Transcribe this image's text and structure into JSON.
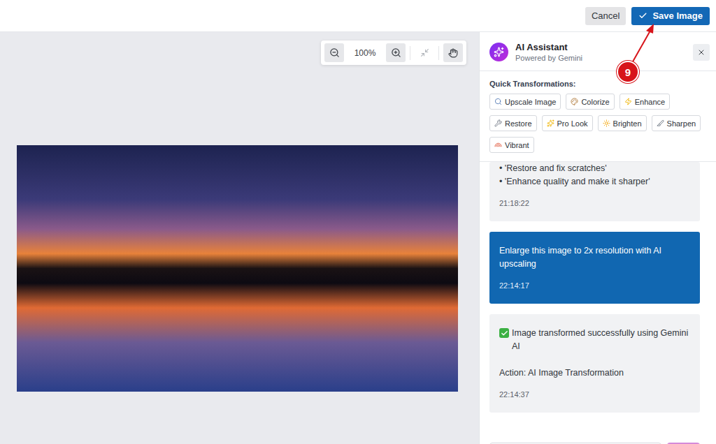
{
  "topbar": {
    "cancel": "Cancel",
    "save": "Save Image"
  },
  "annotation": {
    "badge": "9"
  },
  "zoom": {
    "level": "100%"
  },
  "assistant": {
    "title": "AI Assistant",
    "subtitle": "Powered by Gemini"
  },
  "quick_transformations": {
    "heading": "Quick Transformations:",
    "chips": [
      "Upscale Image",
      "Colorize",
      "Enhance",
      "Restore",
      "Pro Look",
      "Brighten",
      "Sharpen",
      "Vibrant"
    ]
  },
  "messages": [
    {
      "role": "assistant",
      "success": false,
      "lines": [
        "• 'Restore and fix scratches'",
        "• 'Enhance quality and make it sharper'"
      ],
      "time": "21:18:22"
    },
    {
      "role": "user",
      "success": false,
      "lines": [
        "Enlarge this image to 2x resolution with AI upscaling"
      ],
      "time": "22:14:17"
    },
    {
      "role": "assistant",
      "success": true,
      "lines": [
        "Image transformed successfully using Gemini AI",
        "Action: AI Image Transformation"
      ],
      "time": "22:14:37"
    }
  ]
}
